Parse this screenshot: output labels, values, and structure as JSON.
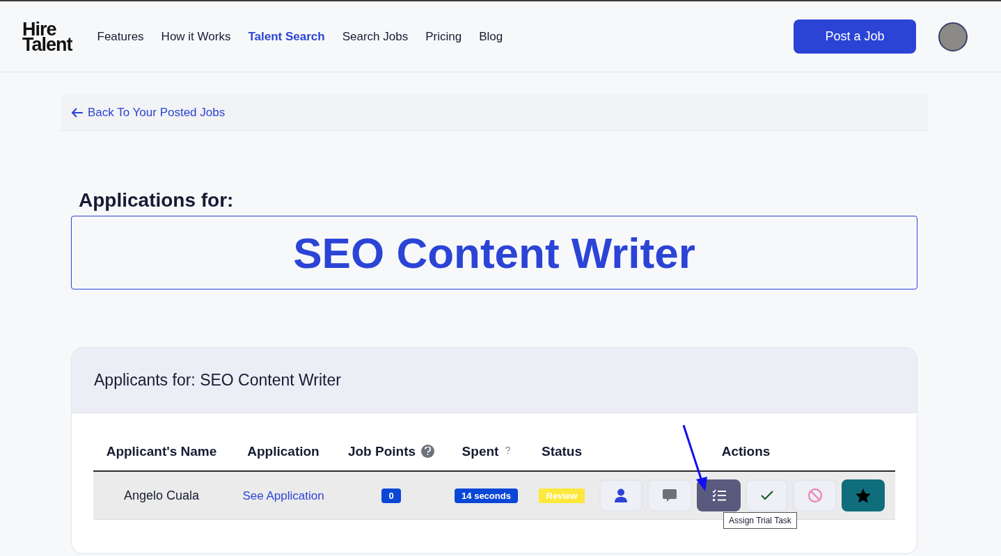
{
  "nav": {
    "logo": {
      "line_1": "Hire",
      "line_2": "Talent"
    },
    "links": [
      {
        "label": "Features",
        "selected": false
      },
      {
        "label": "How it Works",
        "selected": false
      },
      {
        "label": "Talent Search",
        "selected": true
      },
      {
        "label": "Search Jobs",
        "selected": false
      },
      {
        "label": "Pricing",
        "selected": false
      },
      {
        "label": "Blog",
        "selected": false
      }
    ],
    "post_button": "Post a Job"
  },
  "back_link": "Back To Your Posted Jobs",
  "heading": "Applications for:",
  "job_title": "SEO Content Writer",
  "applicants_card": {
    "title": "Applicants for: SEO Content Writer",
    "columns": [
      {
        "label": "Applicant's Name",
        "kind": "plain"
      },
      {
        "label": "Application",
        "kind": "plain"
      },
      {
        "label": "Job Points",
        "kind": "help_circle"
      },
      {
        "label": "Spent",
        "kind": "help_mark"
      },
      {
        "label": "Status",
        "kind": "plain"
      },
      {
        "label": "Actions",
        "kind": "plain"
      }
    ],
    "rows": [
      {
        "name": "Angelo Cuala",
        "application": "See Application",
        "job_points": "0",
        "spent": "14 seconds",
        "status": "Review",
        "actions": [
          {
            "kind": "profile",
            "hovered": false
          },
          {
            "kind": "message",
            "hovered": false
          },
          {
            "kind": "trial",
            "hovered": true
          },
          {
            "kind": "approve",
            "hovered": false
          },
          {
            "kind": "reject",
            "hovered": false
          },
          {
            "kind": "favorite",
            "hovered": false
          }
        ],
        "tooltip": "Assign Trial Task"
      }
    ]
  }
}
